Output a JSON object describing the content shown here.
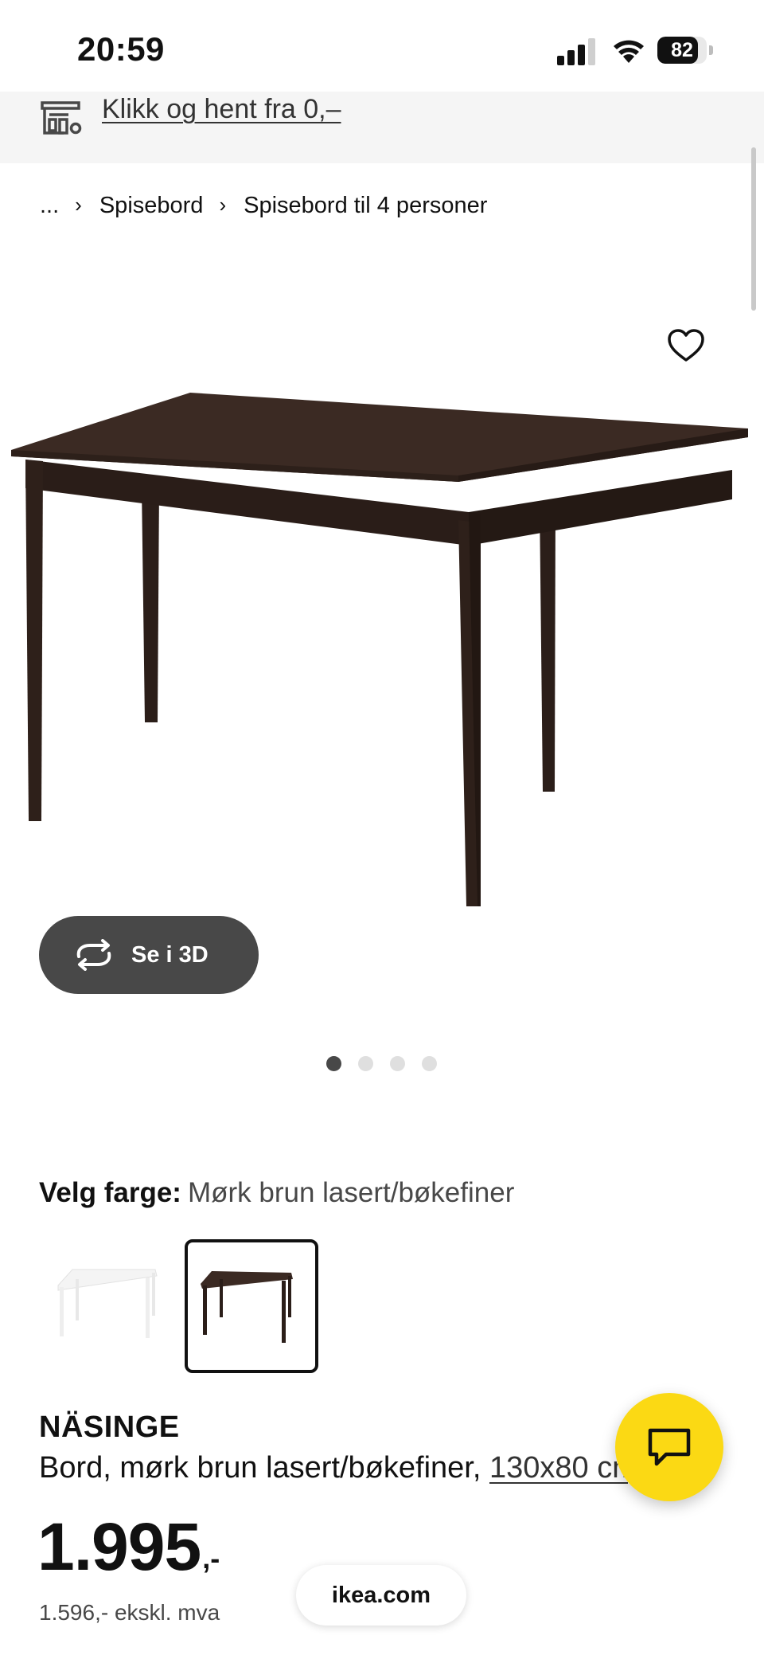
{
  "status_bar": {
    "time": "20:59",
    "battery_percent": "82",
    "battery_level": 0.82
  },
  "pickup_banner": {
    "text": "Klikk og hent fra 0,–",
    "icon": "store-pickup-icon"
  },
  "breadcrumb": {
    "items": [
      "...",
      "Spisebord",
      "Spisebord til 4 personer"
    ],
    "separator": "›"
  },
  "gallery": {
    "favorite_icon": "heart-icon",
    "view_3d_label": "Se i 3D",
    "view_3d_icon": "rotate-arrows-icon",
    "image_count": 4,
    "active_index": 0
  },
  "color_selector": {
    "label": "Velg farge:",
    "value": "Mørk brun lasert/bøkefiner",
    "options": [
      {
        "name": "white",
        "selected": false,
        "color": "#f4f4f4"
      },
      {
        "name": "dark-brown",
        "selected": true,
        "color": "#3a2a22"
      }
    ]
  },
  "product": {
    "name": "NÄSINGE",
    "description": "Bord, mørk brun lasert/bøkefiner, ",
    "size_link": "130x80 cm",
    "price": "1.995",
    "price_suffix": ",-",
    "price_excl_vat": "1.596,- ekskl. mva"
  },
  "url_pill": "ikea.com",
  "chat": {
    "icon": "chat-bubble-icon",
    "color": "#fbd914"
  },
  "colors": {
    "table_wood": "#3b2a23",
    "accent_yellow": "#fbd914",
    "dark_button": "#484848"
  }
}
